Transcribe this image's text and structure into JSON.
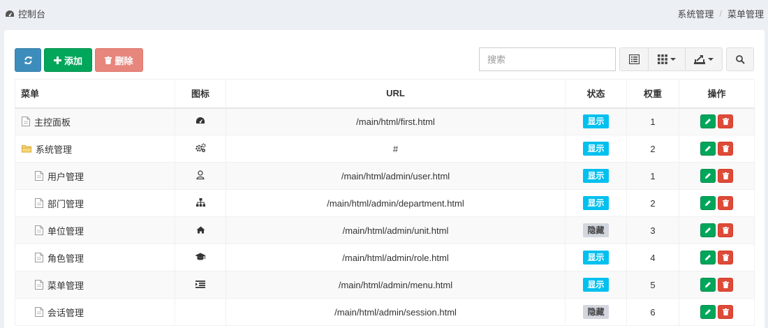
{
  "header": {
    "title": "控制台",
    "breadcrumb": [
      "系统管理",
      "/",
      "菜单管理"
    ]
  },
  "toolbar": {
    "add_label": "添加",
    "delete_label": "删除",
    "search_placeholder": "搜索"
  },
  "table": {
    "columns": [
      "菜单",
      "图标",
      "URL",
      "状态",
      "权重",
      "操作"
    ],
    "rows": [
      {
        "name": "主控面板",
        "icon": "dashboard-icon",
        "url": "/main/html/first.html",
        "status": "显示",
        "weight": "1",
        "level": 0,
        "type": "file"
      },
      {
        "name": "系统管理",
        "icon": "cogs-icon",
        "url": "#",
        "status": "显示",
        "weight": "2",
        "level": 0,
        "type": "folder"
      },
      {
        "name": "用户管理",
        "icon": "user-icon",
        "url": "/main/html/admin/user.html",
        "status": "显示",
        "weight": "1",
        "level": 1,
        "type": "file"
      },
      {
        "name": "部门管理",
        "icon": "sitemap-icon",
        "url": "/main/html/admin/department.html",
        "status": "显示",
        "weight": "2",
        "level": 1,
        "type": "file"
      },
      {
        "name": "单位管理",
        "icon": "home-icon",
        "url": "/main/html/admin/unit.html",
        "status": "隐藏",
        "weight": "3",
        "level": 1,
        "type": "file"
      },
      {
        "name": "角色管理",
        "icon": "graduation-cap-icon",
        "url": "/main/html/admin/role.html",
        "status": "显示",
        "weight": "4",
        "level": 1,
        "type": "file"
      },
      {
        "name": "菜单管理",
        "icon": "indent-icon",
        "url": "/main/html/admin/menu.html",
        "status": "显示",
        "weight": "5",
        "level": 1,
        "type": "file"
      },
      {
        "name": "会话管理",
        "icon": "",
        "url": "/main/html/admin/session.html",
        "status": "隐藏",
        "weight": "6",
        "level": 1,
        "type": "file"
      }
    ]
  },
  "colors": {
    "primary": "#3c8dbc",
    "success": "#00a65a",
    "danger_light": "#e7867c",
    "danger": "#dd4b39",
    "info": "#00c0ef",
    "muted": "#d2d6de"
  }
}
